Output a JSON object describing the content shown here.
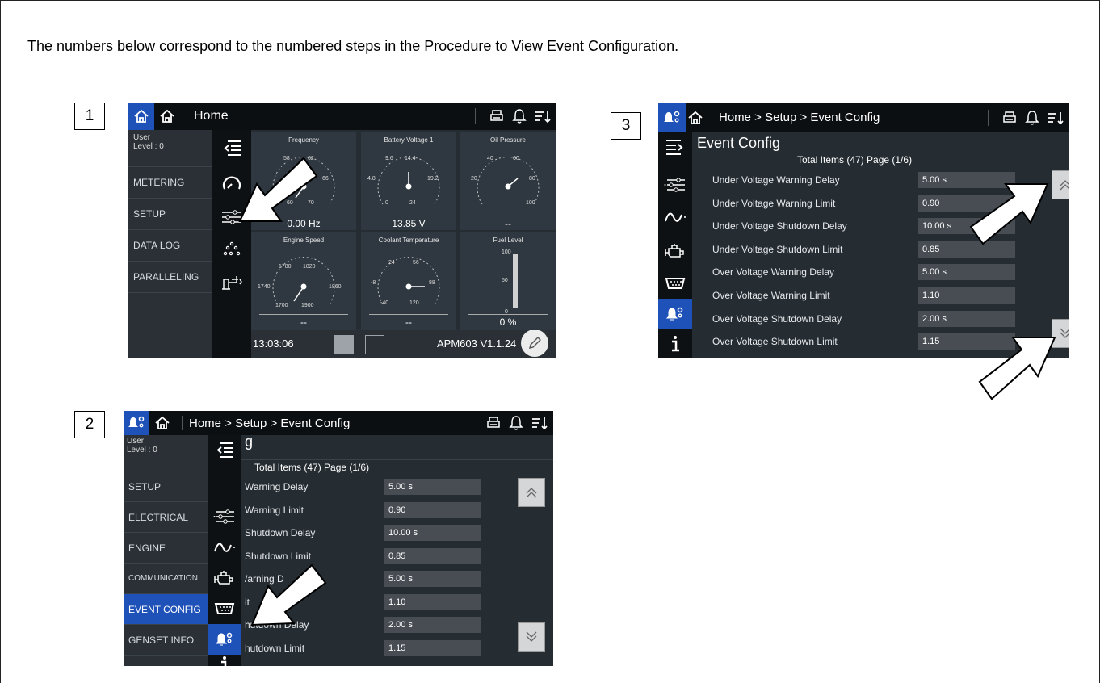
{
  "intro": "The numbers below correspond to the numbered steps in the Procedure to View Event Configuration.",
  "steps": [
    "1",
    "2",
    "3"
  ],
  "screen1": {
    "title": "Home",
    "user_label": "User",
    "level_label": "Level : 0",
    "menu": [
      "METERING",
      "SETUP",
      "DATA LOG",
      "PARALLELING"
    ],
    "gauges": [
      {
        "title": "Frequency",
        "ticks": [
          "58",
          "62",
          "66",
          "70",
          "60"
        ],
        "value": "0.00 Hz"
      },
      {
        "title": "Battery Voltage 1",
        "ticks": [
          "9.6",
          "14.4",
          "4.8",
          "19.2",
          "0",
          "24"
        ],
        "value": "13.85 V"
      },
      {
        "title": "Oil Pressure",
        "ticks": [
          "40",
          "60",
          "20",
          "80",
          "100"
        ],
        "value": "--"
      },
      {
        "title": "Engine Speed",
        "ticks": [
          "1780",
          "1820",
          "1740",
          "1860",
          "1700",
          "1900"
        ],
        "value": "--"
      },
      {
        "title": "Coolant Temperature",
        "ticks": [
          "24",
          "56",
          "-8",
          "88",
          "-40",
          "120"
        ],
        "value": "--"
      },
      {
        "title": "Fuel Level",
        "ticks": [
          "100",
          "50",
          "0"
        ],
        "value": "0 %"
      }
    ],
    "time": "13:03:06",
    "version": "APM603 V1.1.24"
  },
  "screen2": {
    "breadcrumb": "Home > Setup > Event Config",
    "user_label": "User",
    "level_label": "Level : 0",
    "header_partial": "g",
    "total_items": "Total Items (47) Page (1/6)",
    "menu": [
      "SETUP",
      "ELECTRICAL",
      "ENGINE",
      "COMMUNICATION",
      "EVENT CONFIG",
      "GENSET INFO"
    ],
    "rows": [
      {
        "label": "Warning Delay",
        "value": "5.00 s"
      },
      {
        "label": "Warning Limit",
        "value": "0.90"
      },
      {
        "label": "Shutdown Delay",
        "value": "10.00 s"
      },
      {
        "label": "Shutdown Limit",
        "value": "0.85"
      },
      {
        "label": "/arning D",
        "value": "5.00 s"
      },
      {
        "label": "it",
        "value": "1.10"
      },
      {
        "label": "hutdown Delay",
        "value": "2.00 s"
      },
      {
        "label": "hutdown Limit",
        "value": "1.15"
      }
    ]
  },
  "screen3": {
    "breadcrumb": "Home > Setup > Event Config",
    "title": "Event Config",
    "total_items": "Total Items (47) Page (1/6)",
    "rows": [
      {
        "label": "Under Voltage Warning Delay",
        "value": "5.00 s"
      },
      {
        "label": "Under Voltage Warning Limit",
        "value": "0.90"
      },
      {
        "label": "Under Voltage Shutdown Delay",
        "value": "10.00 s"
      },
      {
        "label": "Under Voltage Shutdown Limit",
        "value": "0.85"
      },
      {
        "label": "Over Voltage Warning Delay",
        "value": "5.00 s"
      },
      {
        "label": "Over Voltage Warning Limit",
        "value": "1.10"
      },
      {
        "label": "Over Voltage Shutdown Delay",
        "value": "2.00 s"
      },
      {
        "label": "Over Voltage Shutdown Limit",
        "value": "1.15"
      }
    ]
  },
  "icons": {
    "home": "home-icon",
    "bell": "bell-icon",
    "printer": "printer-icon",
    "sort": "sort-icon",
    "event_config": "event-config-icon",
    "edit": "pencil-icon",
    "scroll_up": "scroll-up-icon",
    "scroll_down": "scroll-down-icon"
  },
  "colors": {
    "accent": "#1f52b8",
    "screen_bg": "#252c32",
    "topbar_bg": "#0c0f12",
    "value_box": "#474d53"
  }
}
